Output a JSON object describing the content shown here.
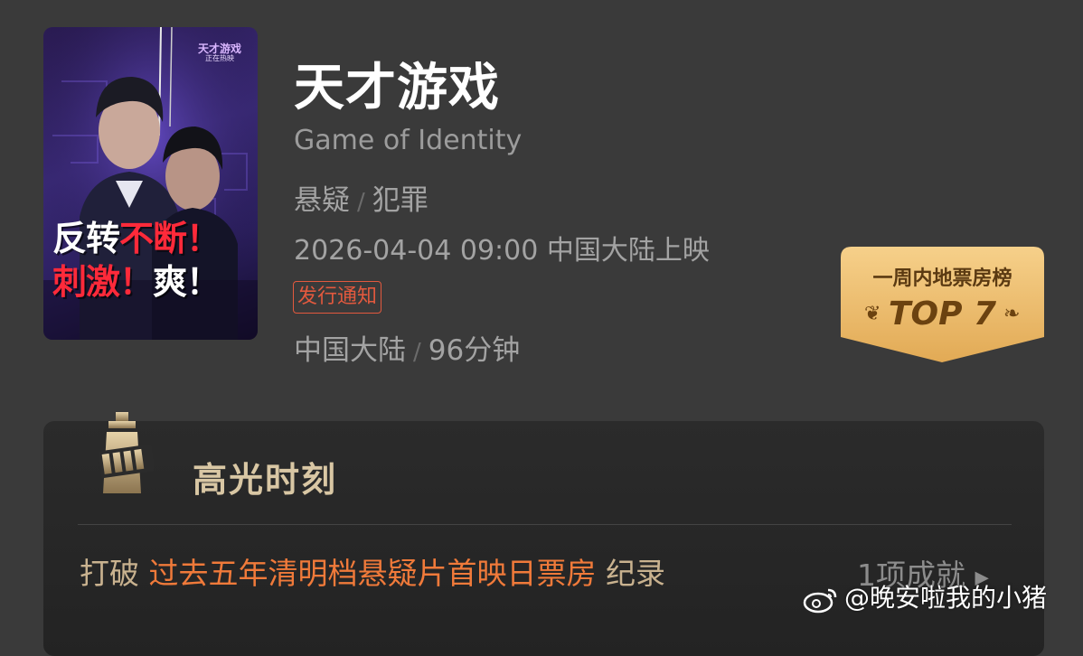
{
  "movie": {
    "title": "天才游戏",
    "english_title": "Game of Identity",
    "genres": [
      "悬疑",
      "犯罪"
    ],
    "genre_separator": "/",
    "release": "2026-04-04 09:00 中国大陆上映",
    "notice_tag": "发行通知",
    "region": "中国大陆",
    "duration": "96分钟",
    "meta_separator": "/"
  },
  "poster": {
    "brand_title": "天才游戏",
    "brand_subtitle": "正在热映",
    "slogan_line1_white": "反转",
    "slogan_line1_red": "不断！",
    "slogan_line2_red": "刺激！",
    "slogan_line2_white": "爽！"
  },
  "ranking": {
    "label": "一周内地票房榜",
    "value": "TOP 7"
  },
  "highlights": {
    "title": "高光时刻",
    "row_prefix": "打破",
    "row_accent": "过去五年清明档悬疑片首映日票房",
    "row_suffix": "纪录",
    "achievements": "1项成就",
    "achievements_arrow": "▶"
  },
  "watermark": {
    "text": "@晚安啦我的小猪"
  },
  "colors": {
    "background": "#3a3a3a",
    "accent_orange": "#f07a3a",
    "badge_gold": "#e8b766",
    "tag_red": "#e2593e"
  }
}
